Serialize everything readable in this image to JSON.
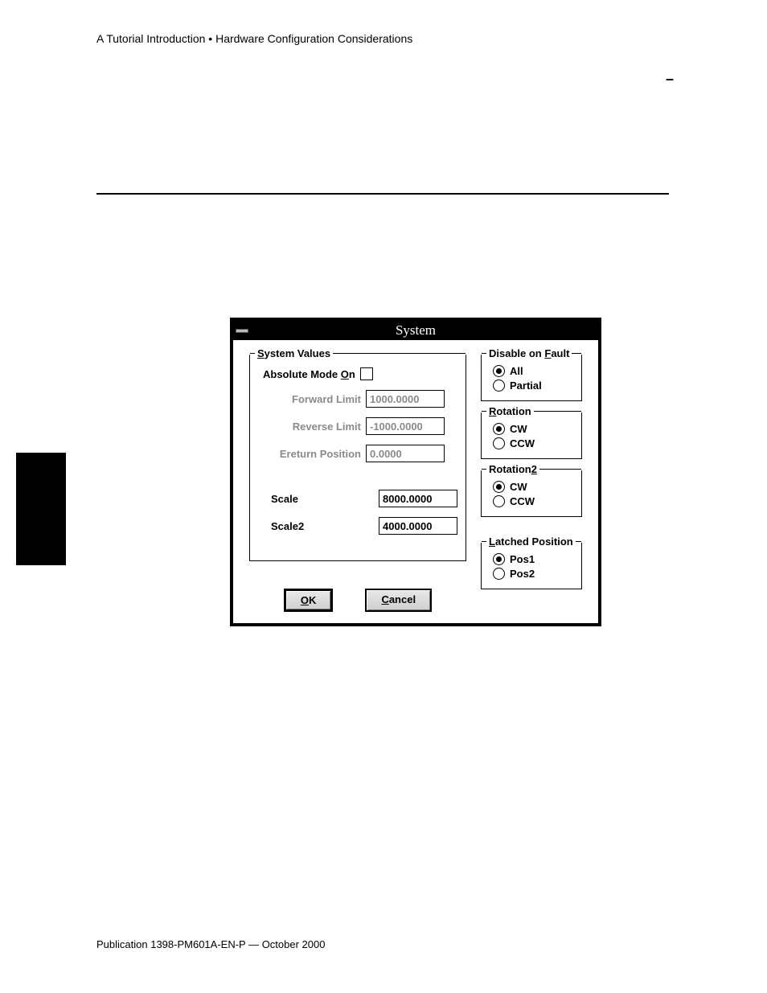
{
  "header": "A Tutorial Introduction • Hardware Configuration Considerations",
  "footer": "Publication 1398-PM601A-EN-P — October 2000",
  "dialog": {
    "title": "System",
    "systemValues": {
      "legend_pre": "S",
      "legend_post": "ystem Values",
      "absoluteMode": {
        "label_pre": "Absolute Mode ",
        "label_u": "O",
        "label_post": "n",
        "checked": false
      },
      "forwardLimit": {
        "label": "Forward Limit",
        "value": "1000.0000",
        "disabled": true
      },
      "reverseLimit": {
        "label": "Reverse Limit",
        "value": "-1000.0000",
        "disabled": true
      },
      "ereturnPosition": {
        "label": "Ereturn Position",
        "value": "0.0000",
        "disabled": true
      },
      "scale": {
        "label": "Scale",
        "value": "8000.0000"
      },
      "scale2": {
        "label": "Scale2",
        "value": "4000.0000"
      }
    },
    "disableOnFault": {
      "legend_pre": "Disable on ",
      "legend_u": "F",
      "legend_post": "ault",
      "options": {
        "all": "All",
        "partial": "Partial"
      },
      "selected": "all"
    },
    "rotation": {
      "legend_u": "R",
      "legend_post": "otation",
      "options": {
        "cw": "CW",
        "ccw": "CCW"
      },
      "selected": "cw"
    },
    "rotation2": {
      "legend_pre": "Rotation",
      "legend_u": "2",
      "options": {
        "cw": "CW",
        "ccw": "CCW"
      },
      "selected": "cw"
    },
    "latched": {
      "legend_u": "L",
      "legend_post": "atched Position",
      "options": {
        "pos1": "Pos1",
        "pos2": "Pos2"
      },
      "selected": "pos1"
    },
    "buttons": {
      "ok_u": "O",
      "ok_post": "K",
      "cancel_u": "C",
      "cancel_post": "ancel"
    }
  }
}
